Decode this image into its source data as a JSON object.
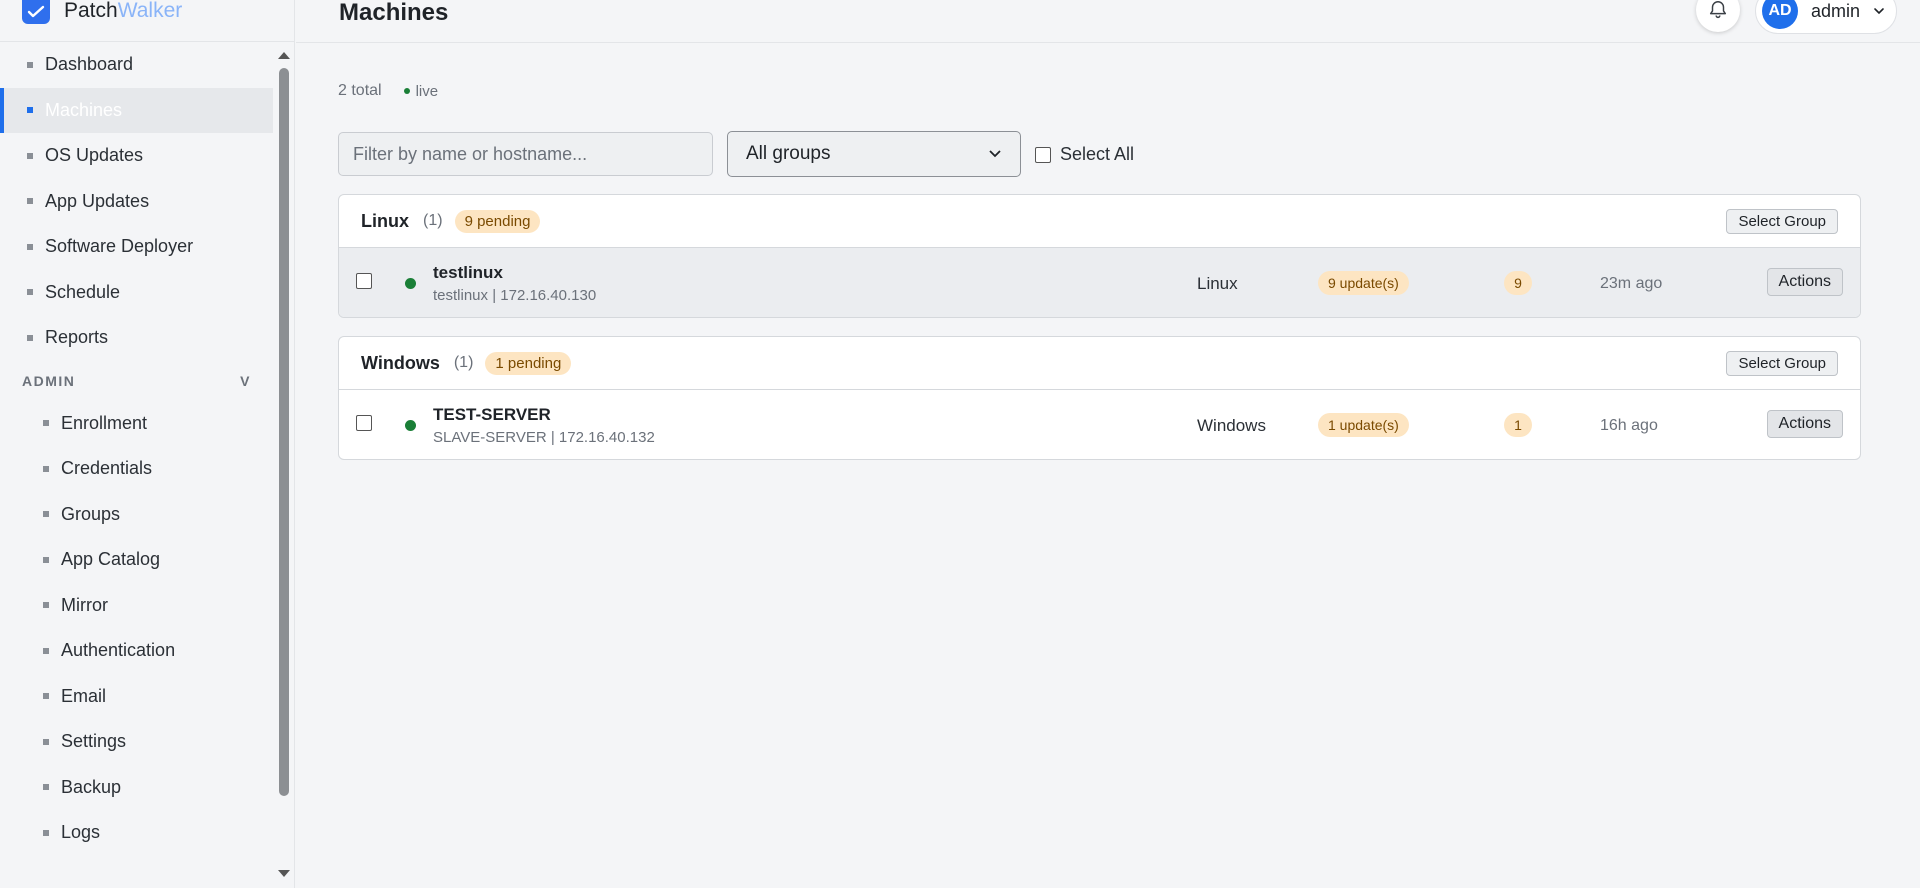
{
  "brand": {
    "name_part1": "Patch",
    "name_part2": "Walker",
    "logo_icon": "check-mark-logo-icon",
    "accent": "#2f6fed"
  },
  "page": {
    "title": "Machines"
  },
  "header": {
    "user": {
      "initials": "AD",
      "name": "admin"
    }
  },
  "sidebar": {
    "items": [
      {
        "label": "Dashboard",
        "active": false
      },
      {
        "label": "Machines",
        "active": true
      },
      {
        "label": "OS Updates",
        "active": false
      },
      {
        "label": "App Updates",
        "active": false
      },
      {
        "label": "Software Deployer",
        "active": false
      },
      {
        "label": "Schedule",
        "active": false
      },
      {
        "label": "Reports",
        "active": false
      }
    ],
    "admin_section": {
      "label": "ADMIN",
      "toggle": "V",
      "items": [
        {
          "label": "Enrollment"
        },
        {
          "label": "Credentials"
        },
        {
          "label": "Groups"
        },
        {
          "label": "App Catalog"
        },
        {
          "label": "Mirror"
        },
        {
          "label": "Authentication"
        },
        {
          "label": "Email"
        },
        {
          "label": "Settings"
        },
        {
          "label": "Backup"
        },
        {
          "label": "Logs"
        }
      ]
    }
  },
  "summary": {
    "total": "2 total",
    "live": "live"
  },
  "filters": {
    "search_placeholder": "Filter by name or hostname...",
    "search_value": "",
    "group_select": "All groups",
    "select_all_label": "Select All"
  },
  "groups": [
    {
      "name": "Linux",
      "count": "(1)",
      "pending": "9 pending",
      "select_label": "Select Group",
      "machines": [
        {
          "name": "testlinux",
          "sub": "testlinux | 172.16.40.130",
          "os": "Linux",
          "updates": "9 update(s)",
          "count": "9",
          "last_seen": "23m ago",
          "actions_label": "Actions"
        }
      ]
    },
    {
      "name": "Windows",
      "count": "(1)",
      "pending": "1 pending",
      "select_label": "Select Group",
      "machines": [
        {
          "name": "TEST-SERVER",
          "sub": "SLAVE-SERVER | 172.16.40.132",
          "os": "Windows",
          "updates": "1 update(s)",
          "count": "1",
          "last_seen": "16h ago",
          "actions_label": "Actions"
        }
      ]
    }
  ],
  "colors": {
    "active_accent": "#1f6feb",
    "online": "#1a7f37",
    "badge_bg": "#fde5c2",
    "badge_text": "#7a4a00"
  }
}
